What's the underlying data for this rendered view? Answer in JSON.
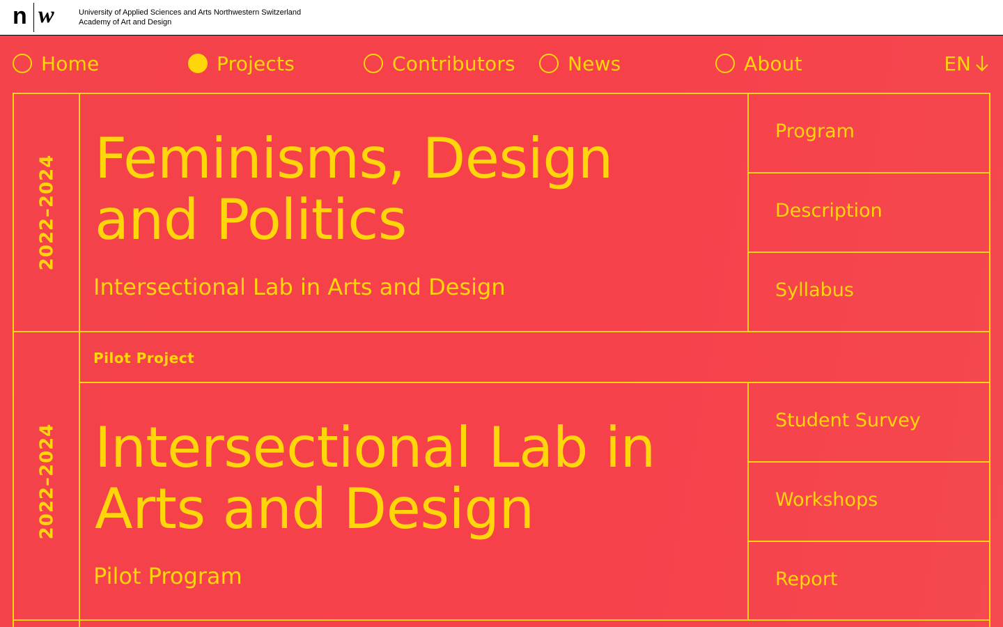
{
  "header": {
    "logo_n": "n",
    "logo_w": "w",
    "institution_line1": "University of Applied Sciences and Arts Northwestern Switzerland",
    "institution_line2": "Academy of Art and Design"
  },
  "nav": {
    "items": [
      {
        "label": "Home",
        "active": false
      },
      {
        "label": "Projects",
        "active": true
      },
      {
        "label": "Contributors",
        "active": false
      },
      {
        "label": "News",
        "active": false
      },
      {
        "label": "About",
        "active": false
      }
    ],
    "language": "EN"
  },
  "colors": {
    "background": "#f4434a",
    "accent": "#ffd60a"
  },
  "projects": [
    {
      "years": "2022–2024",
      "title_line1": "Feminisms, Design",
      "title_line2": "and Politics",
      "subtitle": "Intersectional Lab in Arts and Design",
      "links": [
        "Program",
        "Description",
        "Syllabus"
      ]
    },
    {
      "years": "2022–2024",
      "tag": "Pilot Project",
      "title_line1": "Intersectional Lab in",
      "title_line2": "Arts and Design",
      "subtitle": "Pilot Program",
      "links": [
        "Student Survey",
        "Workshops",
        "Report"
      ]
    }
  ]
}
